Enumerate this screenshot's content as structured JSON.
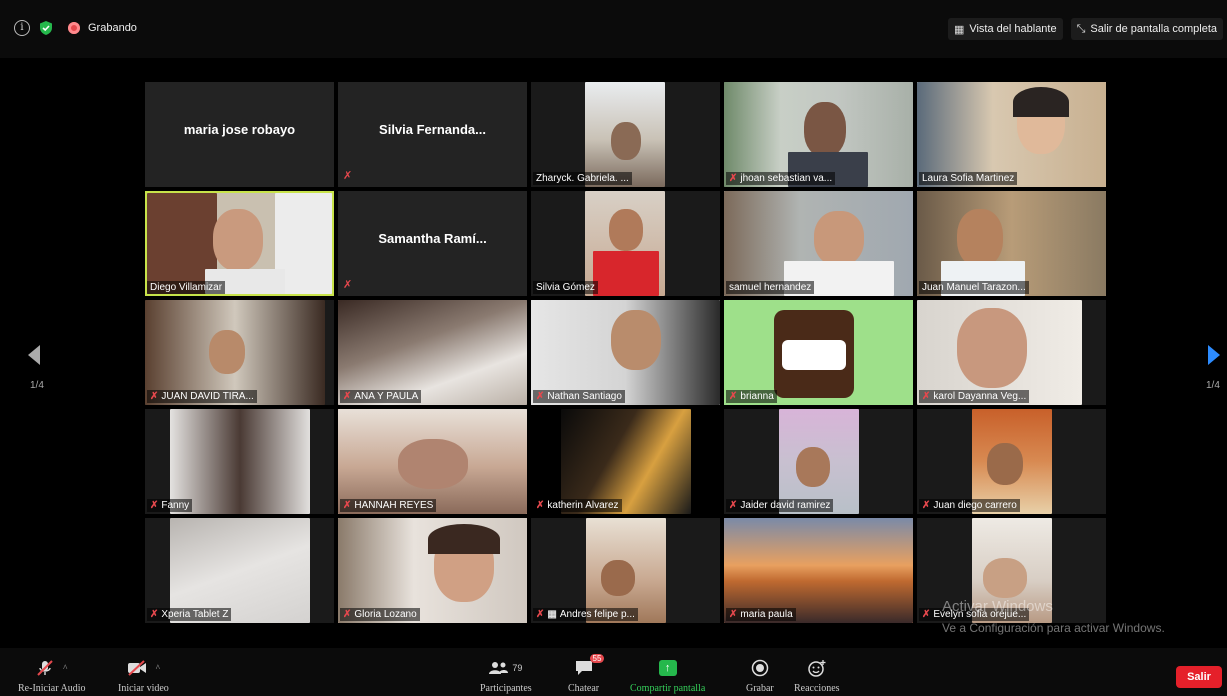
{
  "top": {
    "info_icon": "info-icon",
    "shield_icon": "shield-icon",
    "recording_label": "Grabando",
    "speaker_view": "Vista del hablante",
    "exit_fullscreen": "Salir de pantalla completa"
  },
  "page_indicator_left": "1/4",
  "page_indicator_right": "1/4",
  "participants": [
    {
      "name": "maria jose robayo",
      "type": "name-only",
      "muted": false
    },
    {
      "name": "Silvia  Fernanda...",
      "type": "name-only",
      "muted": true
    },
    {
      "name": "Zharyck.   Gabriela. ...",
      "type": "video",
      "muted": false
    },
    {
      "name": "jhoan sebastian va...",
      "type": "video",
      "muted": true
    },
    {
      "name": "Laura Sofia Martinez",
      "type": "video",
      "muted": false
    },
    {
      "name": "Diego Villamizar",
      "type": "video",
      "muted": false,
      "active_speaker": true
    },
    {
      "name": "Samantha  Ramí...",
      "type": "name-only",
      "muted": true
    },
    {
      "name": "Silvia Gómez",
      "type": "video",
      "muted": false
    },
    {
      "name": "samuel hernandez",
      "type": "video",
      "muted": false
    },
    {
      "name": "Juan Manuel Tarazon...",
      "type": "video",
      "muted": false
    },
    {
      "name": "JUAN DAVID TIRA...",
      "type": "video",
      "muted": true
    },
    {
      "name": "ANA Y PAULA",
      "type": "video",
      "muted": true
    },
    {
      "name": "Nathan Santiago",
      "type": "video",
      "muted": true
    },
    {
      "name": "brianna",
      "type": "video",
      "muted": true
    },
    {
      "name": "karol Dayanna Veg...",
      "type": "video",
      "muted": true
    },
    {
      "name": "Fanny",
      "type": "video",
      "muted": true
    },
    {
      "name": "HANNAH REYES",
      "type": "video",
      "muted": true
    },
    {
      "name": "katherin Alvarez",
      "type": "video",
      "muted": true
    },
    {
      "name": "Jaider david ramirez",
      "type": "video",
      "muted": true
    },
    {
      "name": "Juan diego carrero",
      "type": "video",
      "muted": true
    },
    {
      "name": "Xperia Tablet Z",
      "type": "video",
      "muted": true
    },
    {
      "name": "Gloria Lozano",
      "type": "video",
      "muted": true
    },
    {
      "name": "Andres felipe p...",
      "type": "video",
      "muted": true
    },
    {
      "name": "maria paula",
      "type": "video",
      "muted": true
    },
    {
      "name": "Evelyn sofia orejue...",
      "type": "video",
      "muted": true
    }
  ],
  "watermark": {
    "line1": "Activar Windows",
    "line2": "Ve a Configuración para activar Windows."
  },
  "toolbar": {
    "audio": "Re-Iniciar Audio",
    "video": "Iniciar video",
    "participants": "Participantes",
    "participants_count": "79",
    "chat": "Chatear",
    "chat_badge": "55",
    "share": "Compartir pantalla",
    "record": "Grabar",
    "reactions": "Reacciones",
    "leave": "Salir"
  },
  "colors": {
    "active_speaker_border": "#c8e34a",
    "share_green": "#25b84c",
    "leave_red": "#e5202a",
    "mute_red": "#e5484d"
  }
}
